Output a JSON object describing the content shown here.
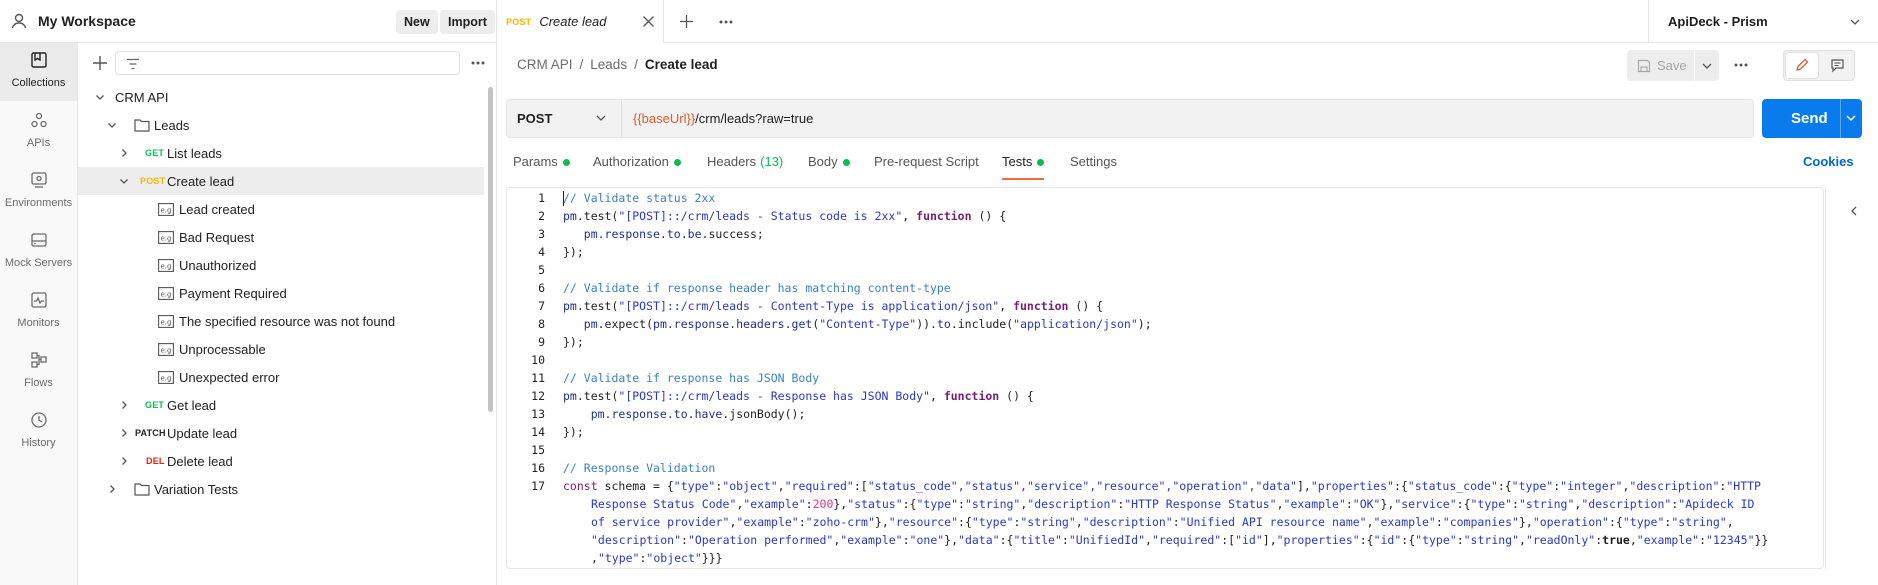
{
  "workspace": {
    "name": "My Workspace",
    "new_label": "New",
    "import_label": "Import"
  },
  "rail": [
    {
      "label": "Collections",
      "icon": "collections-icon",
      "active": true
    },
    {
      "label": "APIs",
      "icon": "apis-icon"
    },
    {
      "label": "Environments",
      "icon": "environments-icon"
    },
    {
      "label": "Mock Servers",
      "icon": "mock-servers-icon"
    },
    {
      "label": "Monitors",
      "icon": "monitors-icon"
    },
    {
      "label": "Flows",
      "icon": "flows-icon"
    },
    {
      "label": "History",
      "icon": "history-icon"
    }
  ],
  "tree": {
    "collection": "CRM API",
    "folder": "Leads",
    "items": [
      {
        "method": "GET",
        "label": "List leads"
      },
      {
        "method": "POST",
        "label": "Create lead"
      },
      {
        "method": "GET",
        "label": "Get lead"
      },
      {
        "method": "PATCH",
        "label": "Update lead"
      },
      {
        "method": "DEL",
        "label": "Delete lead"
      }
    ],
    "examples": [
      "Lead created",
      "Bad Request",
      "Unauthorized",
      "Payment Required",
      "The specified resource was not found",
      "Unprocessable",
      "Unexpected error"
    ],
    "folder2": "Variation Tests"
  },
  "tab": {
    "method": "POST",
    "name": "Create lead"
  },
  "environment": "ApiDeck - Prism",
  "breadcrumb": {
    "part1": "CRM API",
    "part2": "Leads",
    "current": "Create lead",
    "sep": "/"
  },
  "save_label": "Save",
  "request": {
    "method": "POST",
    "url_var": "{{baseUrl}}",
    "url_path": "/crm/leads?raw=true",
    "send_label": "Send"
  },
  "req_tabs": {
    "params": "Params",
    "authorization": "Authorization",
    "headers": "Headers",
    "headers_count": "(13)",
    "body": "Body",
    "prerequest": "Pre-request Script",
    "tests": "Tests",
    "settings": "Settings"
  },
  "cookies_label": "Cookies",
  "code": {
    "l1": "// Validate status 2xx",
    "l2_a": "pm",
    "l2_b": ".test(",
    "l2_c": "\"[POST]::/crm/leads - Status code is 2xx\"",
    "l2_d": ", ",
    "l2_e": "function",
    "l2_f": " () {",
    "l3_a": "   pm",
    "l3_b": ".response.",
    "l3_c": "to",
    "l3_d": ".",
    "l3_e": "be",
    "l3_f": ".success;",
    "l4": "});",
    "l6": "// Validate if response header has matching content-type",
    "l7_a": "pm",
    "l7_b": ".test(",
    "l7_c": "\"[POST]::/crm/leads - Content-Type is application/json\"",
    "l7_d": ", ",
    "l7_e": "function",
    "l7_f": " () {",
    "l8_a": "   pm",
    "l8_b": ".expect(",
    "l8_c": "pm",
    "l8_d": ".response.",
    "l8_e": "headers",
    "l8_f": ".",
    "l8_g": "get",
    "l8_h": "(",
    "l8_i": "\"Content-Type\"",
    "l8_j": ")).",
    "l8_k": "to",
    "l8_l": ".include(",
    "l8_m": "\"application/json\"",
    "l8_n": ");",
    "l9": "});",
    "l11": "// Validate if response has JSON Body",
    "l12_a": "pm",
    "l12_b": ".test(",
    "l12_c": "\"[POST]::/crm/leads - Response has JSON Body\"",
    "l12_d": ", ",
    "l12_e": "function",
    "l12_f": " () {",
    "l13_a": "    pm",
    "l13_b": ".response.",
    "l13_c": "to",
    "l13_d": ".",
    "l13_e": "have",
    "l13_f": ".jsonBody();",
    "l14": "});",
    "l16": "// Response Validation",
    "l17_1_a": "const",
    "l17_1_b": " schema = {",
    "l17_1_c": "\"type\"",
    "l17_1_d": ":",
    "l17_1_e": "\"object\"",
    "l17_1_f": ",",
    "l17_1_g": "\"required\"",
    "l17_1_h": ":[",
    "l17_1_i": "\"status_code\",\"status\",\"service\",\"resource\",\"operation\",\"data\"",
    "l17_1_j": "],",
    "l17_1_k": "\"properties\"",
    "l17_1_l": ":{",
    "l17_1_m": "\"status_code\"",
    "l17_1_n": ":{",
    "l17_1_o": "\"type\"",
    "l17_1_p": ":",
    "l17_1_q": "\"integer\"",
    "l17_1_r": ",",
    "l17_1_s": "\"description\"",
    "l17_1_t": ":",
    "l17_1_u": "\"HTTP",
    "l17_2_a": "Response Status Code\"",
    "l17_2_b": ",",
    "l17_2_c": "\"example\"",
    "l17_2_d": ":",
    "l17_2_e": "200",
    "l17_2_f": "},",
    "l17_2_g": "\"status\"",
    "l17_2_h": ":{",
    "l17_2_i": "\"type\"",
    "l17_2_j": ":",
    "l17_2_k": "\"string\"",
    "l17_2_l": ",",
    "l17_2_m": "\"description\"",
    "l17_2_n": ":",
    "l17_2_o": "\"HTTP Response Status\"",
    "l17_2_p": ",",
    "l17_2_q": "\"example\"",
    "l17_2_r": ":",
    "l17_2_s": "\"OK\"",
    "l17_2_t": "},",
    "l17_2_u": "\"service\"",
    "l17_2_v": ":{",
    "l17_2_w": "\"type\"",
    "l17_2_x": ":",
    "l17_2_y": "\"string\"",
    "l17_2_z": ",",
    "l17_2_aa": "\"description\"",
    "l17_2_ab": ":",
    "l17_2_ac": "\"Apideck ID",
    "l17_3_a": "of service provider\"",
    "l17_3_b": ",",
    "l17_3_c": "\"example\"",
    "l17_3_d": ":",
    "l17_3_e": "\"zoho-crm\"",
    "l17_3_f": "},",
    "l17_3_g": "\"resource\"",
    "l17_3_h": ":{",
    "l17_3_i": "\"type\"",
    "l17_3_j": ":",
    "l17_3_k": "\"string\"",
    "l17_3_l": ",",
    "l17_3_m": "\"description\"",
    "l17_3_n": ":",
    "l17_3_o": "\"Unified API resource name\"",
    "l17_3_p": ",",
    "l17_3_q": "\"example\"",
    "l17_3_r": ":",
    "l17_3_s": "\"companies\"",
    "l17_3_t": "},",
    "l17_3_u": "\"operation\"",
    "l17_3_v": ":{",
    "l17_3_w": "\"type\"",
    "l17_3_x": ":",
    "l17_3_y": "\"string\"",
    "l17_3_z": ",",
    "l17_4_a": "\"description\"",
    "l17_4_b": ":",
    "l17_4_c": "\"Operation performed\"",
    "l17_4_d": ",",
    "l17_4_e": "\"example\"",
    "l17_4_f": ":",
    "l17_4_g": "\"one\"",
    "l17_4_h": "},",
    "l17_4_i": "\"data\"",
    "l17_4_j": ":{",
    "l17_4_k": "\"title\"",
    "l17_4_l": ":",
    "l17_4_m": "\"UnifiedId\"",
    "l17_4_n": ",",
    "l17_4_o": "\"required\"",
    "l17_4_p": ":[",
    "l17_4_q": "\"id\"",
    "l17_4_r": "],",
    "l17_4_s": "\"properties\"",
    "l17_4_t": ":{",
    "l17_4_u": "\"id\"",
    "l17_4_v": ":{",
    "l17_4_w": "\"type\"",
    "l17_4_x": ":",
    "l17_4_y": "\"string\"",
    "l17_4_z": ",",
    "l17_4_aa": "\"readOnly\"",
    "l17_4_ab": ":",
    "l17_4_ac": "true",
    "l17_4_ad": ",",
    "l17_4_ae": "\"example\"",
    "l17_4_af": ":",
    "l17_4_ag": "\"12345\"",
    "l17_4_ah": "}}",
    "l17_5_a": ",",
    "l17_5_b": "\"type\"",
    "l17_5_c": ":",
    "l17_5_d": "\"object\"",
    "l17_5_e": "}}}"
  },
  "line_numbers": [
    "1",
    "2",
    "3",
    "4",
    "5",
    "6",
    "7",
    "8",
    "9",
    "10",
    "11",
    "12",
    "13",
    "14",
    "15",
    "16",
    "17"
  ]
}
